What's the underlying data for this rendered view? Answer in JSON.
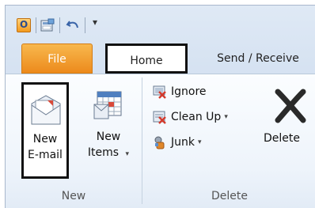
{
  "qat": {
    "customize_glyph": "▾"
  },
  "tabs": [
    {
      "label": "File"
    },
    {
      "label": "Home"
    },
    {
      "label": "Send / Receive"
    }
  ],
  "groups": {
    "new": {
      "label": "New",
      "new_email": {
        "line1": "New",
        "line2": "E-mail"
      },
      "new_items": {
        "line1": "New",
        "line2": "Items",
        "arrow": "▾"
      }
    },
    "delete": {
      "label": "Delete",
      "ignore": {
        "label": "Ignore"
      },
      "clean_up": {
        "label": "Clean Up",
        "arrow": "▾"
      },
      "junk": {
        "label": "Junk",
        "arrow": "▾"
      },
      "delete_button": {
        "label": "Delete"
      }
    }
  },
  "colors": {
    "file_tab": "#ec8a1c",
    "ribbon_bg": "#eef4fb",
    "highlight_border": "#111111"
  }
}
